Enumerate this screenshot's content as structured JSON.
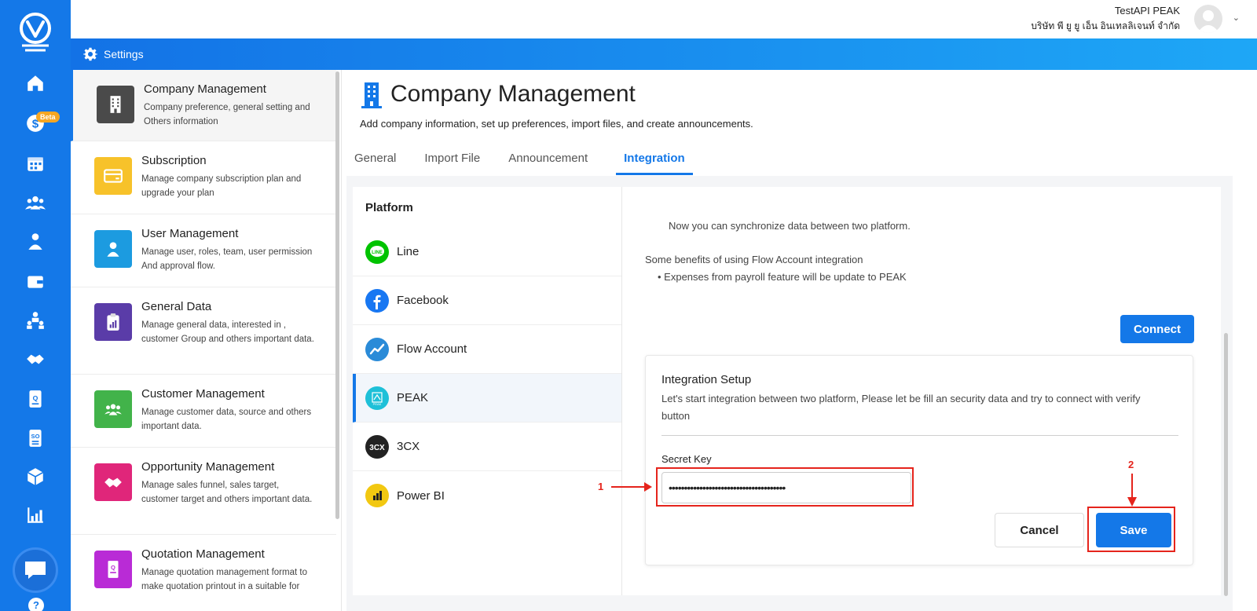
{
  "rail": {
    "beta_badge": "Beta",
    "help": "?",
    "items": [
      {
        "icon": "home-icon"
      },
      {
        "icon": "sales-icon"
      },
      {
        "icon": "calendar-icon"
      },
      {
        "icon": "team-icon"
      },
      {
        "icon": "contact-icon"
      },
      {
        "icon": "wallet-icon"
      },
      {
        "icon": "organization-icon"
      },
      {
        "icon": "handshake-icon"
      },
      {
        "icon": "quotation-icon"
      },
      {
        "icon": "sales-order-icon"
      },
      {
        "icon": "product-box-icon"
      },
      {
        "icon": "report-chart-icon"
      }
    ]
  },
  "header": {
    "user_name": "TestAPI PEAK",
    "company_name": "บริษัท พี ยู ยู เอ็น อินเทลลิเจนท์ จำกัด"
  },
  "settings_bar": {
    "label": "Settings"
  },
  "menu": {
    "items": [
      {
        "title": "Company Management",
        "desc": "Company preference, general setting and Others information",
        "color": "#4a4a4a",
        "icon": "building-icon"
      },
      {
        "title": "Subscription",
        "desc": "Manage company subscription plan and upgrade your plan",
        "color": "#f7c22a",
        "icon": "card-icon"
      },
      {
        "title": "User Management",
        "desc": "Manage user, roles, team, user permission And approval flow.",
        "color": "#1c9be0",
        "icon": "user-icon"
      },
      {
        "title": "General Data",
        "desc": "Manage general data, interested in , customer Group and others important data.",
        "color": "#5a3ca8",
        "icon": "clipboard-icon"
      },
      {
        "title": "Customer Management",
        "desc": "Manage customer data, source and others important data.",
        "color": "#42b34a",
        "icon": "customers-icon"
      },
      {
        "title": "Opportunity Management",
        "desc": "Manage sales funnel, sales target, customer target and others important data.",
        "color": "#e0267a",
        "icon": "handshake-icon"
      },
      {
        "title": "Quotation Management",
        "desc": "Manage quotation management format to make quotation printout in a suitable for",
        "color": "#b92bd6",
        "icon": "quotation-icon"
      }
    ]
  },
  "page": {
    "title": "Company Management",
    "subtitle": "Add company information, set up preferences, import files, and create announcements.",
    "tabs": [
      "General",
      "Import File",
      "Announcement",
      "Integration"
    ],
    "active_tab": "Integration"
  },
  "platforms": {
    "heading": "Platform",
    "items": [
      {
        "name": "Line",
        "color": "#00c300",
        "icon": "line-icon"
      },
      {
        "name": "Facebook",
        "color": "#1877f2",
        "icon": "facebook-icon"
      },
      {
        "name": "Flow Account",
        "color": "#2a8bd8",
        "icon": "flow-account-icon"
      },
      {
        "name": "PEAK",
        "color": "#1ec0d8",
        "icon": "peak-icon"
      },
      {
        "name": "3CX",
        "color": "#222222",
        "icon": "3cx-icon"
      },
      {
        "name": "Power BI",
        "color": "#f2c811",
        "icon": "power-bi-icon"
      }
    ],
    "active": "PEAK"
  },
  "detail": {
    "sync_text": "Now you can synchronize data between two platform.",
    "benefits_title": "Some benefits of using Flow Account integration",
    "benefit_item": "•  Expenses from payroll feature will be update to PEAK",
    "connect_label": "Connect",
    "setup": {
      "title": "Integration Setup",
      "desc": "Let's start integration between two platform, Please let be fill an security data and try to connect with verify button",
      "key_label": "Secret Key",
      "key_value": "••••••••••••••••••••••••••••••••••••••",
      "cancel_label": "Cancel",
      "save_label": "Save"
    }
  },
  "annotations": {
    "step1": "1",
    "step2": "2",
    "color": "#e5241c"
  }
}
